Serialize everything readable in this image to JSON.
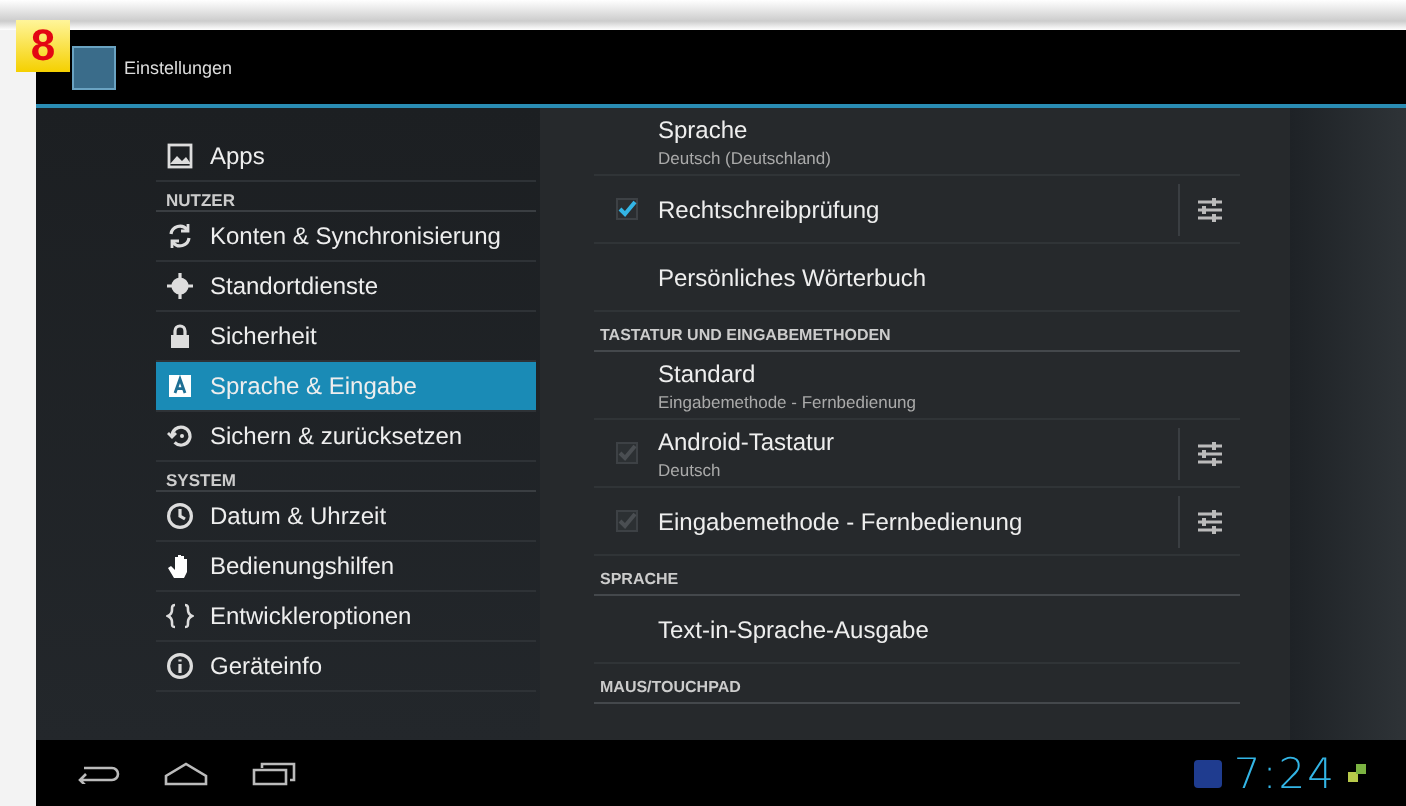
{
  "badge": "8",
  "action_bar": {
    "title": "Einstellungen"
  },
  "sidebar": [
    {
      "items": [
        {
          "label": "Apps",
          "selected": false
        }
      ]
    },
    {
      "header": "NUTZER",
      "items": [
        {
          "label": "Konten & Synchronisierung",
          "selected": false
        },
        {
          "label": "Standortdienste",
          "selected": false
        },
        {
          "label": "Sicherheit",
          "selected": false
        },
        {
          "label": "Sprache & Eingabe",
          "selected": true
        },
        {
          "label": "Sichern & zurücksetzen",
          "selected": false
        }
      ]
    },
    {
      "header": "SYSTEM",
      "items": [
        {
          "label": "Datum & Uhrzeit",
          "selected": false
        },
        {
          "label": "Bedienungshilfen",
          "selected": false
        },
        {
          "label": "Entwickleroptionen",
          "selected": false
        },
        {
          "label": "Geräteinfo",
          "selected": false
        }
      ]
    }
  ],
  "preferences": [
    {
      "kind": "item",
      "title": "Sprache",
      "summary": "Deutsch (Deutschland)"
    },
    {
      "kind": "check",
      "title": "Rechtschreibprüfung",
      "checked": true,
      "disabled": false,
      "settings": true
    },
    {
      "kind": "item",
      "title": "Persönliches Wörterbuch"
    },
    {
      "kind": "header",
      "title": "TASTATUR UND EINGABEMETHODEN"
    },
    {
      "kind": "item",
      "title": "Standard",
      "summary": "Eingabemethode - Fernbedienung"
    },
    {
      "kind": "check",
      "title": "Android-Tastatur",
      "summary": "Deutsch",
      "checked": true,
      "disabled": true,
      "settings": true
    },
    {
      "kind": "check",
      "title": "Eingabemethode - Fernbedienung",
      "checked": true,
      "disabled": true,
      "settings": true
    },
    {
      "kind": "header",
      "title": "SPRACHE"
    },
    {
      "kind": "item",
      "title": "Text-in-Sprache-Ausgabe"
    },
    {
      "kind": "header",
      "title": "MAUS/TOUCHPAD"
    }
  ],
  "status_bar": {
    "time": "7:24"
  }
}
